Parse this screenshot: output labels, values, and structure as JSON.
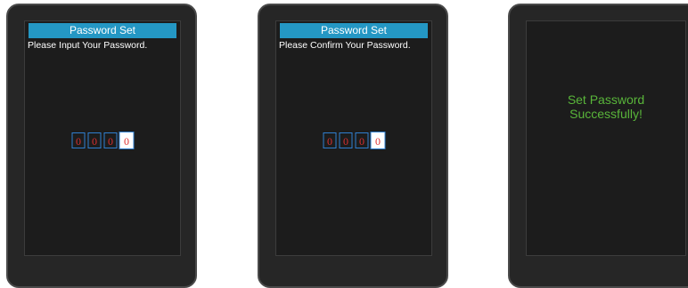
{
  "screens": [
    {
      "title": "Password Set",
      "prompt": "Please Input Your Password.",
      "digits": [
        "0",
        "0",
        "0",
        "0"
      ]
    },
    {
      "title": "Password Set",
      "prompt": "Please Confirm Your Password.",
      "digits": [
        "0",
        "0",
        "0",
        "0"
      ]
    },
    {
      "message_line1": "Set Password",
      "message_line2": "Successfully!"
    }
  ],
  "colors": {
    "title_bar": "#2497c4",
    "digit_text": "#d83030",
    "digit_border": "#2f7fd0",
    "success_text": "#59b53a"
  }
}
